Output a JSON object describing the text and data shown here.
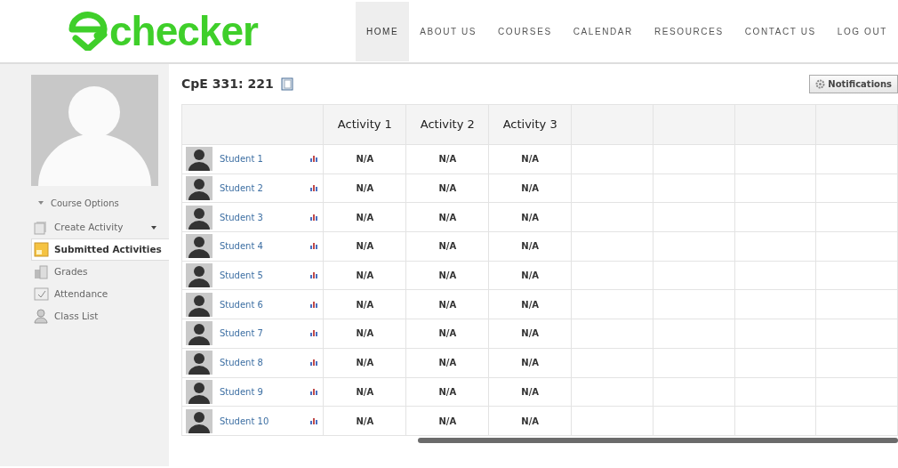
{
  "logo": {
    "text": "checker"
  },
  "nav": [
    {
      "label": "HOME",
      "selected": true
    },
    {
      "label": "ABOUT US",
      "selected": false
    },
    {
      "label": "COURSES",
      "selected": false
    },
    {
      "label": "CALENDAR",
      "selected": false
    },
    {
      "label": "RESOURCES",
      "selected": false
    },
    {
      "label": "CONTACT US",
      "selected": false
    },
    {
      "label": "LOG OUT",
      "selected": false
    }
  ],
  "sidebar": {
    "section": "Course Options",
    "items": [
      {
        "label": "Create Activity",
        "kind": "dropdown",
        "selected": false
      },
      {
        "label": "Submitted Activities",
        "kind": "link",
        "selected": true
      },
      {
        "label": "Grades",
        "kind": "link",
        "selected": false
      },
      {
        "label": "Attendance",
        "kind": "link",
        "selected": false
      },
      {
        "label": "Class List",
        "kind": "link",
        "selected": false
      }
    ]
  },
  "course": {
    "title": "CpE 331: 221"
  },
  "notifications_button": "Notifications",
  "table": {
    "columns": [
      "Activity 1",
      "Activity 2",
      "Activity 3"
    ],
    "rows": [
      {
        "name": "Student 1",
        "cells": [
          "N/A",
          "N/A",
          "N/A"
        ]
      },
      {
        "name": "Student 2",
        "cells": [
          "N/A",
          "N/A",
          "N/A"
        ]
      },
      {
        "name": "Student 3",
        "cells": [
          "N/A",
          "N/A",
          "N/A"
        ]
      },
      {
        "name": "Student 4",
        "cells": [
          "N/A",
          "N/A",
          "N/A"
        ]
      },
      {
        "name": "Student 5",
        "cells": [
          "N/A",
          "N/A",
          "N/A"
        ]
      },
      {
        "name": "Student 6",
        "cells": [
          "N/A",
          "N/A",
          "N/A"
        ]
      },
      {
        "name": "Student 7",
        "cells": [
          "N/A",
          "N/A",
          "N/A"
        ]
      },
      {
        "name": "Student 8",
        "cells": [
          "N/A",
          "N/A",
          "N/A"
        ]
      },
      {
        "name": "Student 9",
        "cells": [
          "N/A",
          "N/A",
          "N/A"
        ]
      },
      {
        "name": "Student 10",
        "cells": [
          "N/A",
          "N/A",
          "N/A"
        ]
      }
    ]
  }
}
